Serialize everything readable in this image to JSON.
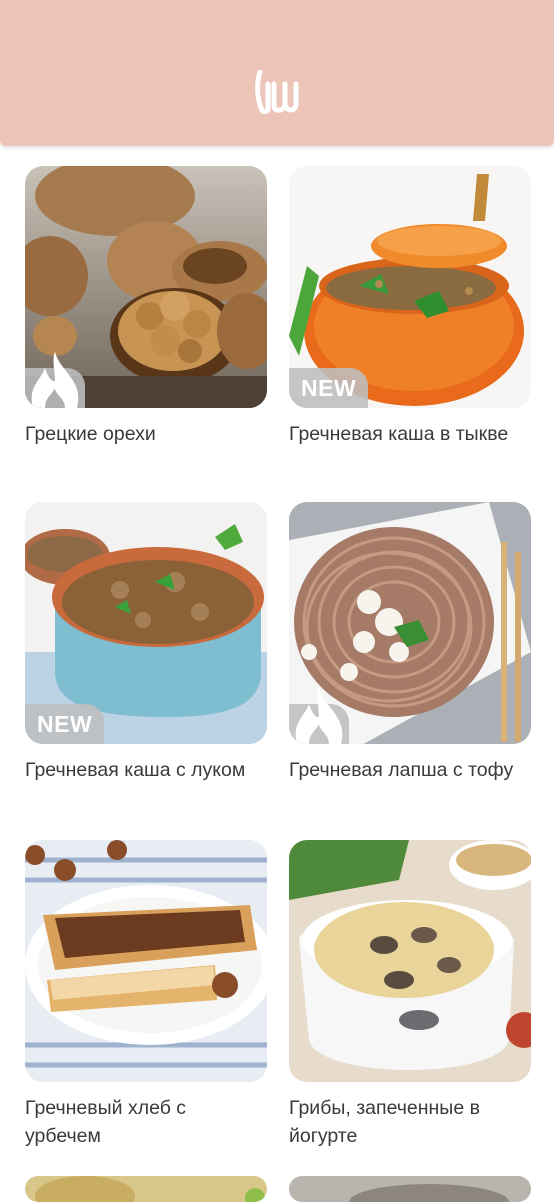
{
  "header": {
    "logo_icon": "brand-logo-icon",
    "background": "#ecc4b8"
  },
  "recipes": [
    {
      "title": "Грецкие орехи",
      "badge": "hot",
      "badge_icon": "flame-icon"
    },
    {
      "title": "Гречневая каша в тыкве",
      "badge": "new",
      "badge_text": "NEW"
    },
    {
      "title": "Гречневая каша с луком",
      "badge": "new",
      "badge_text": "NEW"
    },
    {
      "title": "Гречневая лапша с тофу",
      "badge": "hot",
      "badge_icon": "flame-icon"
    },
    {
      "title": "Гречневый хлеб с урбечем",
      "badge": "none"
    },
    {
      "title": "Грибы, запеченные в йогурте",
      "badge": "none"
    }
  ]
}
